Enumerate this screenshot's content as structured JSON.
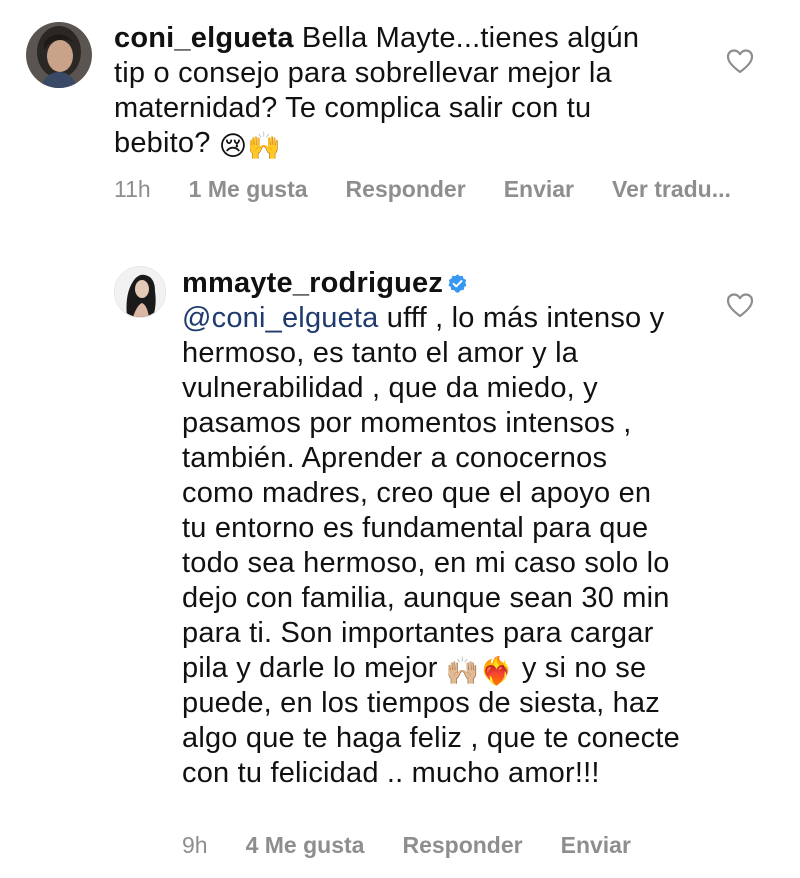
{
  "comments": [
    {
      "username": "coni_elgueta",
      "verified": false,
      "text": " Bella Mayte...tienes algún tip o consejo para sobrellevar mejor la maternidad? Te complica salir con tu bebito? ",
      "emojis": [
        "😢",
        "🙌"
      ],
      "avatar_icon": "profile-photo-icon",
      "time": "11h",
      "likes_label": "1 Me gusta",
      "reply_label": "Responder",
      "send_label": "Enviar",
      "translate_label": "Ver tradu..."
    },
    {
      "username": "mmayte_rodriguez",
      "verified": true,
      "mention": "@coni_elgueta",
      "text_part1": " ufff , lo más intenso y hermoso, es tanto el amor y la vulnerabilidad , que da miedo, y pasamos por momentos intensos , también. Aprender a conocernos como madres, creo que el apoyo en tu entorno es fundamental para que todo sea hermoso, en mi caso solo lo dejo con familia, aunque sean 30 min para ti. Son importantes para cargar pila y darle lo mejor ",
      "emojis": [
        "🙌🏼",
        "❤️‍🔥"
      ],
      "text_part2": " y si no se puede, en los tiempos de siesta, haz algo que te haga feliz , que te conecte con tu felicidad .. mucho amor!!!",
      "avatar_icon": "profile-photo-icon",
      "time": "9h",
      "likes_label": "4 Me gusta",
      "reply_label": "Responder",
      "send_label": "Enviar"
    }
  ],
  "colors": {
    "text": "#111111",
    "muted": "#8e8e8e",
    "mention": "#1f3a6e",
    "verified": "#3897f0"
  }
}
